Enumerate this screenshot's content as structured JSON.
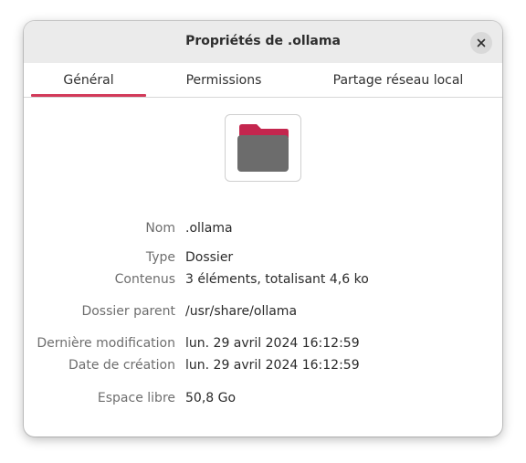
{
  "dialog": {
    "title": "Propriétés de .ollama",
    "close_icon": "close-icon"
  },
  "tabs": [
    {
      "label": "Général",
      "selected": true
    },
    {
      "label": "Permissions",
      "selected": false
    },
    {
      "label": "Partage réseau local",
      "selected": false
    }
  ],
  "accent_color": "#d23a5a",
  "folder_icon": {
    "name": "folder-icon",
    "tab_color": "#c4264e",
    "body_color": "#6c6c6c"
  },
  "properties": {
    "name": {
      "label": "Nom",
      "value": ".ollama"
    },
    "type": {
      "label": "Type",
      "value": "Dossier"
    },
    "contents": {
      "label": "Contenus",
      "value": "3 éléments, totalisant 4,6 ko"
    },
    "parent": {
      "label": "Dossier parent",
      "value": "/usr/share/ollama"
    },
    "modified": {
      "label": "Dernière modification",
      "value": "lun. 29 avril 2024 16:12:59"
    },
    "created": {
      "label": "Date de création",
      "value": "lun. 29 avril 2024 16:12:59"
    },
    "free_space": {
      "label": "Espace libre",
      "value": "50,8 Go"
    }
  }
}
